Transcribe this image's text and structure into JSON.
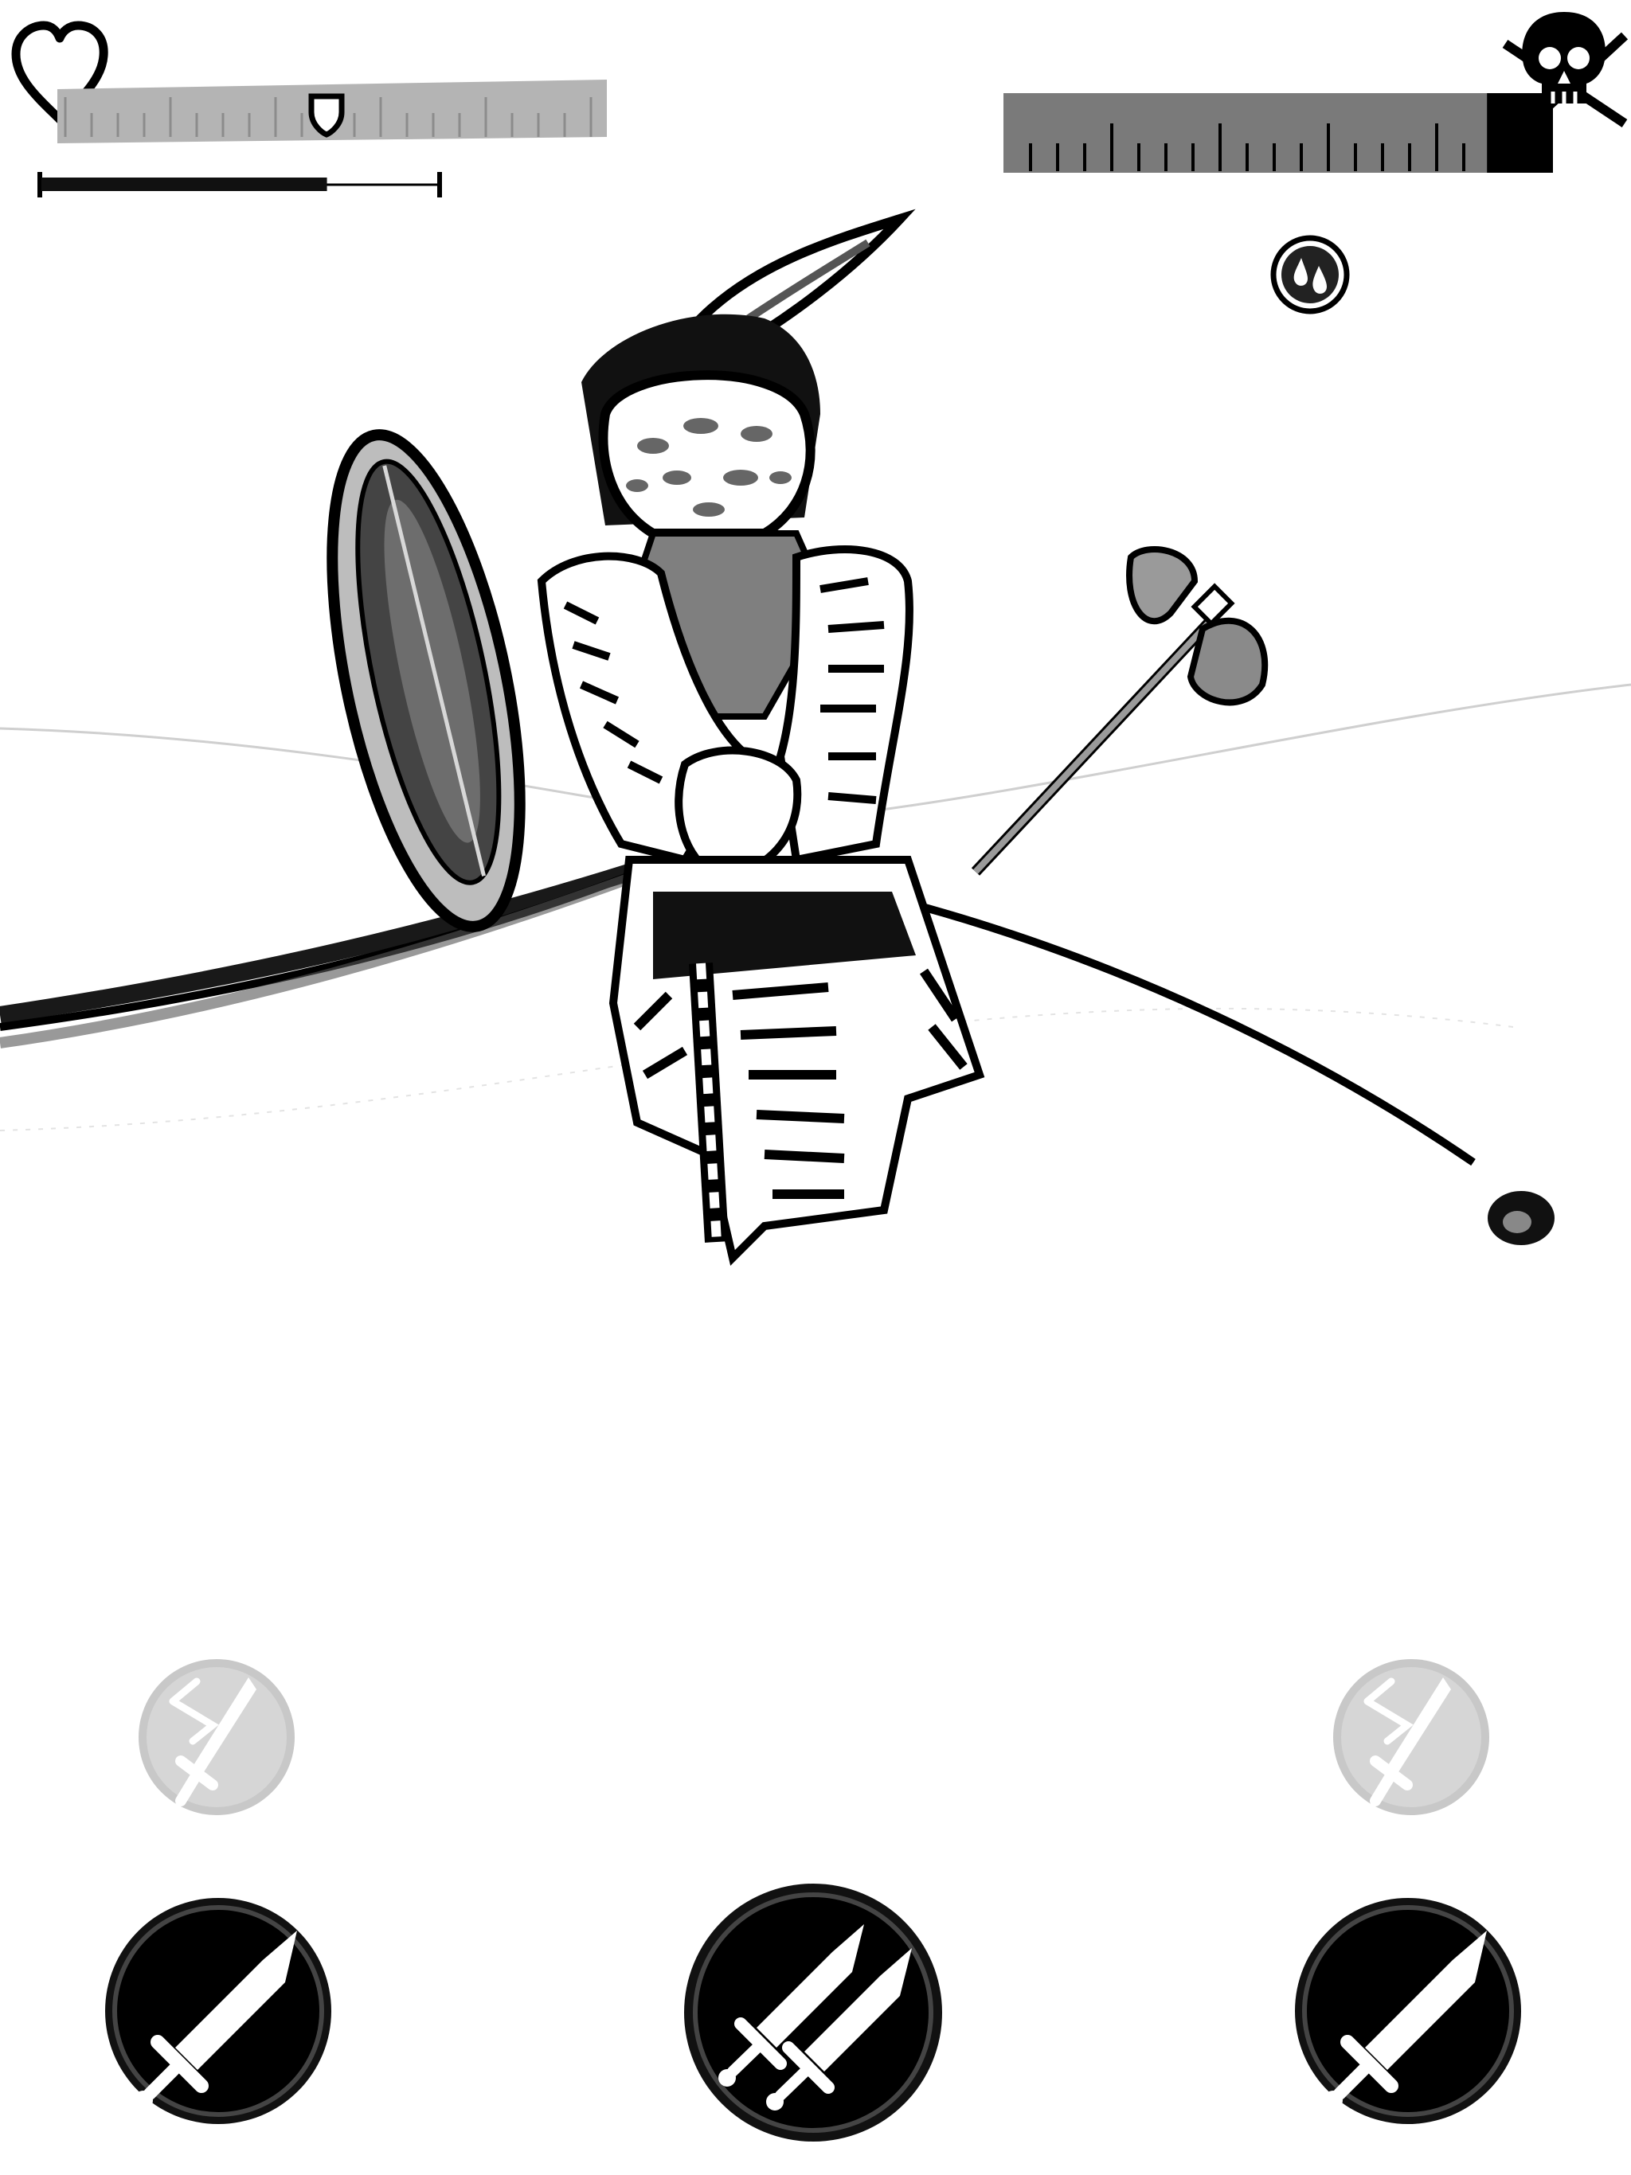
{
  "hud": {
    "player": {
      "icon": "heart-icon",
      "health_fraction": 1.0,
      "armor_marker_icon": "shield-icon",
      "stamina_fraction": 0.72,
      "bar_color": "#b4b4b4"
    },
    "enemy": {
      "icon": "skull-crossbones-icon",
      "health_fraction": 0.88,
      "bar_color": "#7a7a7a",
      "status_effect_icon": "bleed-drops-icon"
    }
  },
  "scene": {
    "enemy_figure": "masked-warrior",
    "thrown_items": [
      "round-shield-icon",
      "double-axe-icon"
    ],
    "weapon_arc": "spear-arc"
  },
  "controls": {
    "special_left": {
      "icon": "sword-dash-icon",
      "enabled": false
    },
    "special_right": {
      "icon": "sword-dash-icon",
      "enabled": false
    },
    "attack_left": {
      "icon": "sword-icon"
    },
    "attack_center": {
      "icon": "double-sword-icon"
    },
    "attack_right": {
      "icon": "sword-icon"
    }
  },
  "colors": {
    "ink": "#000000",
    "paper": "#ffffff",
    "disabled": "#c8c8c8",
    "mid_gray": "#8a8a8a"
  }
}
